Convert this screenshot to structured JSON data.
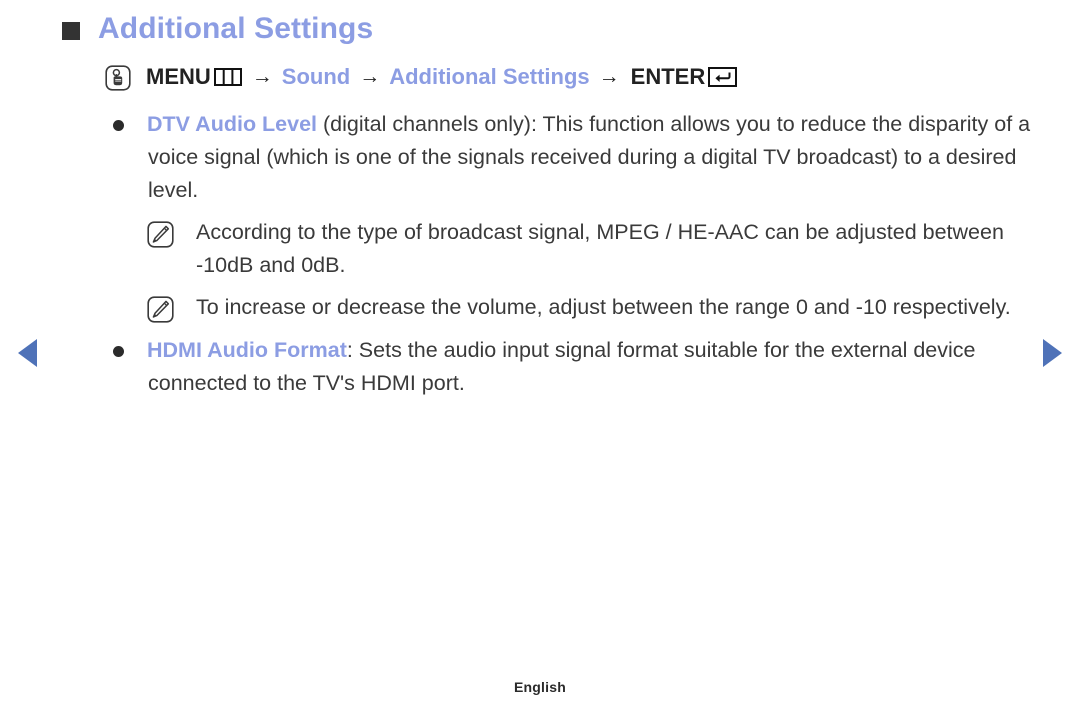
{
  "heading": {
    "bullet_icon": "square-bullet-icon",
    "title": "Additional Settings"
  },
  "menu_path": {
    "press_icon": "hand-press-icon",
    "menu_label": "MENU",
    "menu_icon": "menu-bars-icon",
    "arrow": "→",
    "step_sound": "Sound",
    "step_additional_settings": "Additional Settings",
    "enter_label": "ENTER",
    "enter_icon": "enter-return-icon"
  },
  "items": [
    {
      "bullet_icon": "dot-bullet-icon",
      "term": "DTV Audio Level",
      "body": " (digital channels only): This function allows you to reduce the disparity of a voice signal (which is one of the signals received during a digital TV broadcast) to a desired level.",
      "notes": [
        {
          "icon": "note-pencil-icon",
          "text_before": "According to the type of broadcast signal, ",
          "highlight_1": "MPEG",
          "separator": " / ",
          "highlight_2": "HE-AAC",
          "text_after": " can be adjusted between -10dB and 0dB."
        },
        {
          "icon": "note-pencil-icon",
          "text_before": "To increase or decrease the volume, adjust between the range 0 and -10 respectively.",
          "highlight_1": "",
          "separator": "",
          "highlight_2": "",
          "text_after": ""
        }
      ]
    },
    {
      "bullet_icon": "dot-bullet-icon",
      "term": "HDMI Audio Format",
      "body": ": Sets the audio input signal format suitable for the external device connected to the TV's HDMI port.",
      "notes": []
    }
  ],
  "navigation": {
    "prev_icon": "prev-page-arrow-icon",
    "next_icon": "next-page-arrow-icon"
  },
  "footer": {
    "language": "English"
  },
  "colors": {
    "accent_blue": "#8c9de3",
    "nav_arrow_blue": "#4f72b8",
    "body_text": "#3a3a3a",
    "bullet_dark": "#333333"
  }
}
